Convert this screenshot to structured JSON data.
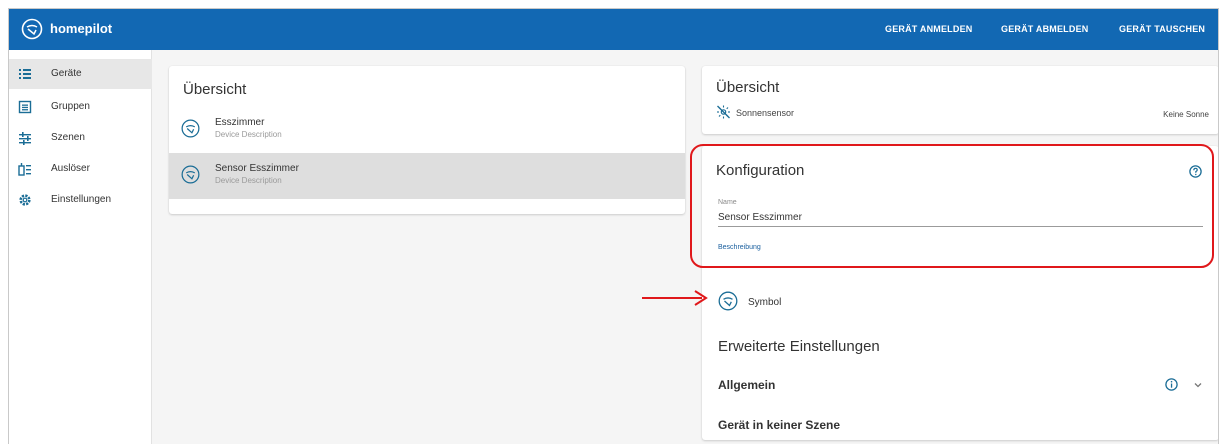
{
  "app": {
    "brand": "homepilot"
  },
  "header": {
    "actions": [
      {
        "label": "GERÄT ANMELDEN"
      },
      {
        "label": "GERÄT ABMELDEN"
      },
      {
        "label": "GERÄT TAUSCHEN"
      }
    ]
  },
  "sidebar": {
    "items": [
      {
        "label": "Geräte",
        "icon": "list-icon"
      },
      {
        "label": "Gruppen",
        "icon": "group-list-icon"
      },
      {
        "label": "Szenen",
        "icon": "scene-sliders-icon"
      },
      {
        "label": "Auslöser",
        "icon": "trigger-icon"
      },
      {
        "label": "Einstellungen",
        "icon": "settings-icon"
      }
    ]
  },
  "overview": {
    "title": "Übersicht",
    "devices": [
      {
        "name": "Esszimmer",
        "description": "Device Description"
      },
      {
        "name": "Sensor Esszimmer",
        "description": "Device Description"
      }
    ]
  },
  "detail": {
    "overview_title": "Übersicht",
    "sensor": {
      "label": "Sonnensensor",
      "status": "Keine Sonne"
    },
    "config": {
      "title": "Konfiguration",
      "name_label": "Name",
      "name_value": "Sensor Esszimmer",
      "description_label": "Beschreibung"
    },
    "symbol_label": "Symbol",
    "advanced_title": "Erweiterte Einstellungen",
    "general_label": "Allgemein",
    "scene_label": "Gerät in keiner Szene"
  },
  "colors": {
    "brand_blue": "#1268b3",
    "highlight_red": "#e0181b",
    "icon_teal": "#1b6d96"
  }
}
